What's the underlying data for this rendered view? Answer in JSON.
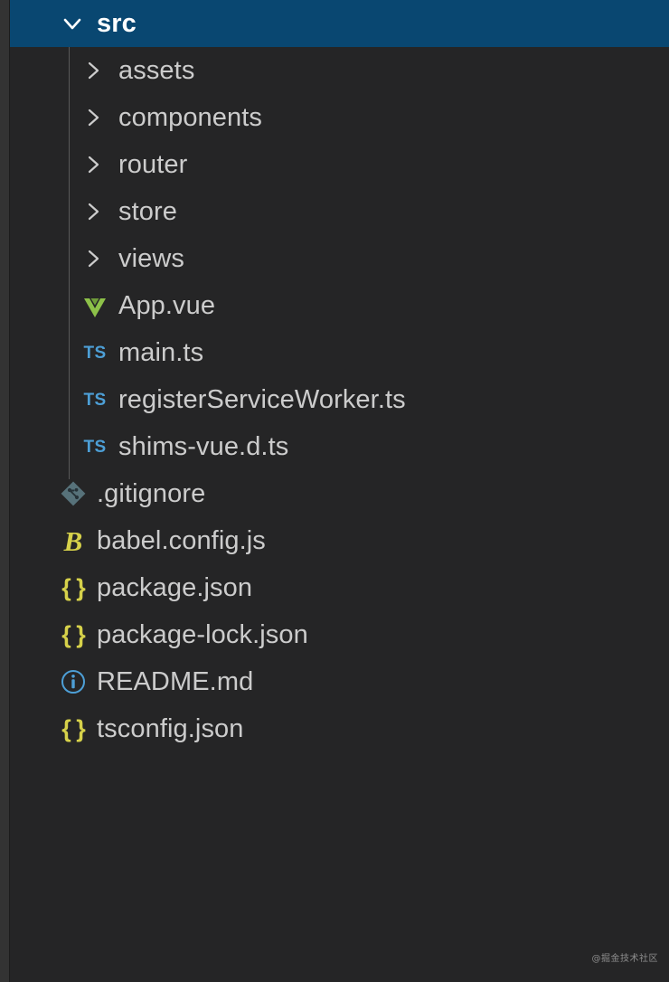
{
  "explorer": {
    "root": {
      "label": "src",
      "icon": "chevron-down-icon",
      "selected": true
    },
    "items": [
      {
        "label": "assets",
        "icon": "chevron-right-icon",
        "kind": "folder",
        "depth": 2
      },
      {
        "label": "components",
        "icon": "chevron-right-icon",
        "kind": "folder",
        "depth": 2
      },
      {
        "label": "router",
        "icon": "chevron-right-icon",
        "kind": "folder",
        "depth": 2
      },
      {
        "label": "store",
        "icon": "chevron-right-icon",
        "kind": "folder",
        "depth": 2
      },
      {
        "label": "views",
        "icon": "chevron-right-icon",
        "kind": "folder",
        "depth": 2
      },
      {
        "label": "App.vue",
        "icon": "vue-file-icon",
        "kind": "file",
        "depth": 2
      },
      {
        "label": "main.ts",
        "icon": "typescript-file-icon",
        "kind": "file",
        "depth": 2
      },
      {
        "label": "registerServiceWorker.ts",
        "icon": "typescript-file-icon",
        "kind": "file",
        "depth": 2
      },
      {
        "label": "shims-vue.d.ts",
        "icon": "typescript-file-icon",
        "kind": "file",
        "depth": 2
      },
      {
        "label": ".gitignore",
        "icon": "git-file-icon",
        "kind": "file",
        "depth": 1
      },
      {
        "label": "babel.config.js",
        "icon": "babel-file-icon",
        "kind": "file",
        "depth": 1
      },
      {
        "label": "package.json",
        "icon": "json-file-icon",
        "kind": "file",
        "depth": 1
      },
      {
        "label": "package-lock.json",
        "icon": "json-file-icon",
        "kind": "file",
        "depth": 1
      },
      {
        "label": "README.md",
        "icon": "info-file-icon",
        "kind": "file",
        "depth": 1
      },
      {
        "label": "tsconfig.json",
        "icon": "json-file-icon",
        "kind": "file",
        "depth": 1
      }
    ]
  },
  "badges": {
    "typescript": "TS",
    "json": "{ }",
    "babel": "B"
  },
  "colors": {
    "selection": "#094771",
    "background": "#252526",
    "text": "#cccccc",
    "text_selected": "#ffffff",
    "typescript_blue": "#4d9fd6",
    "json_yellow": "#d6d14a",
    "vue_green": "#8dc149",
    "git_gray": "#57727a",
    "info_blue": "#4d9fd6",
    "indent_guide": "#585858"
  },
  "watermark": {
    "text": "@掘金技术社区"
  }
}
